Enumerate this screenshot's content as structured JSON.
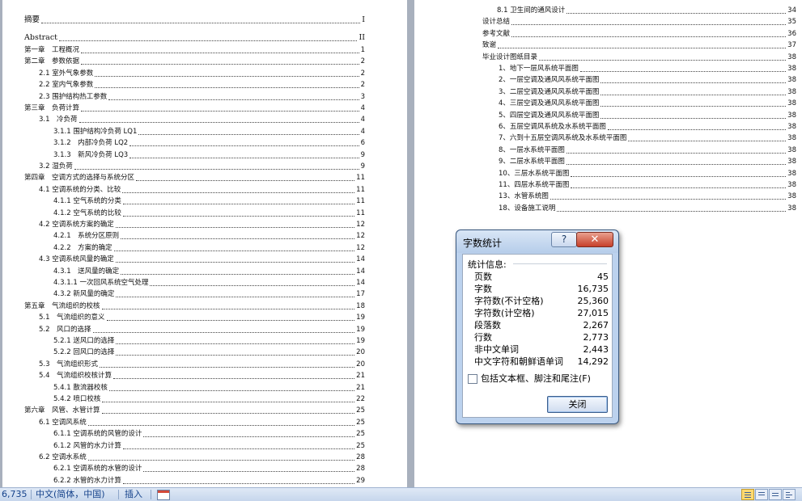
{
  "toc_left": [
    {
      "text": "摘要",
      "page": "I",
      "big": true
    },
    {
      "text": "Abstract",
      "page": "II",
      "big": true
    },
    {
      "text": "第一章　工程概况",
      "page": "1"
    },
    {
      "text": "第二章　参数依据",
      "page": "2"
    },
    {
      "text": "2.1 室外气象参数",
      "page": "2"
    },
    {
      "text": "2.2 室内气象参数",
      "page": "2"
    },
    {
      "text": "2.3 围护结构热工参数",
      "page": "3"
    },
    {
      "text": "第三章　负荷计算",
      "page": "4"
    },
    {
      "text": "3.1　冷负荷",
      "page": "4"
    },
    {
      "text": "3.1.1 围护结构冷负荷 LQ1",
      "page": "4"
    },
    {
      "text": "3.1.2　内部冷负荷 LQ2",
      "page": "6"
    },
    {
      "text": "3.1.3　新风冷负荷 LQ3",
      "page": "9"
    },
    {
      "text": "3.2 湿负荷",
      "page": "9"
    },
    {
      "text": "第四章　空调方式的选择与系统分区",
      "page": "11"
    },
    {
      "text": "4.1 空调系统的分类、比较",
      "page": "11"
    },
    {
      "text": "4.1.1 空气系统的分类",
      "page": "11"
    },
    {
      "text": "4.1.2 空气系统的比较",
      "page": "11"
    },
    {
      "text": "4.2 空调系统方案的确定",
      "page": "12"
    },
    {
      "text": "4.2.1　系统分区原则",
      "page": "12"
    },
    {
      "text": "4.2.2　方案的确定",
      "page": "12"
    },
    {
      "text": "4.3 空调系统风量的确定",
      "page": "14"
    },
    {
      "text": "4.3.1　送风量的确定",
      "page": "14"
    },
    {
      "text": "4.3.1.1 一次回风系统空气处理",
      "page": "14"
    },
    {
      "text": "4.3.2 新风量的确定",
      "page": "17"
    },
    {
      "text": "第五章　气流组织的校核",
      "page": "18"
    },
    {
      "text": "5.1　气流组织的意义",
      "page": "19"
    },
    {
      "text": "5.2　风口的选择",
      "page": "19"
    },
    {
      "text": "5.2.1 送风口的选择",
      "page": "19"
    },
    {
      "text": "5.2.2 回风口的选择",
      "page": "20"
    },
    {
      "text": "5.3　气流组织形式",
      "page": "20"
    },
    {
      "text": "5.4　气流组织校核计算",
      "page": "21"
    },
    {
      "text": "5.4.1 散流器校核",
      "page": "21"
    },
    {
      "text": "5.4.2 喷口校核",
      "page": "22"
    },
    {
      "text": "第六章　风管、水管计算",
      "page": "25"
    },
    {
      "text": "6.1 空调风系统",
      "page": "25"
    },
    {
      "text": "6.1.1 空调系统的风管的设计",
      "page": "25"
    },
    {
      "text": "6.1.2 风管的水力计算",
      "page": "25"
    },
    {
      "text": "6.2 空调水系统",
      "page": "28"
    },
    {
      "text": "6.2.1 空调系统的水管的设计",
      "page": "28"
    },
    {
      "text": "6.2.2 水管的水力计算",
      "page": "29"
    }
  ],
  "toc_right": [
    {
      "text": "8.1 卫生间的通风设计",
      "page": "34"
    },
    {
      "text": "设计总结",
      "page": "35"
    },
    {
      "text": "参考文献",
      "page": "36"
    },
    {
      "text": "致谢",
      "page": "37"
    },
    {
      "text": "毕业设计图纸目录",
      "page": "38"
    },
    {
      "text": "1、地下一层风系统平面图",
      "page": "38"
    },
    {
      "text": "2、一层空调及通风风系统平面图",
      "page": "38"
    },
    {
      "text": "3、二层空调及通风风系统平面图",
      "page": "38"
    },
    {
      "text": "4、三层空调及通风风系统平面图",
      "page": "38"
    },
    {
      "text": "5、四层空调及通风风系统平面图",
      "page": "38"
    },
    {
      "text": "6、五层空调风系统及水系统平面图",
      "page": "38"
    },
    {
      "text": "7、六到十五层空调风系统及水系统平面图",
      "page": "38"
    },
    {
      "text": "8、一层水系统平面图",
      "page": "38"
    },
    {
      "text": "9、二层水系统平面图",
      "page": "38"
    },
    {
      "text": "10、三层水系统平面图",
      "page": "38"
    },
    {
      "text": "11、四层水系统平面图",
      "page": "38"
    },
    {
      "text": "13、水管系统图",
      "page": "38"
    },
    {
      "text": "18、设备施工说明",
      "page": "38"
    }
  ],
  "status_bar": {
    "word_count": "6,735",
    "language": "中文(简体，中国)",
    "mode": "插入"
  },
  "dialog": {
    "title": "字数统计",
    "help_label": "?",
    "close_x_label": "✕",
    "section_label": "统计信息:",
    "stats": [
      {
        "label": "页数",
        "value": "45"
      },
      {
        "label": "字数",
        "value": "16,735"
      },
      {
        "label": "字符数(不计空格)",
        "value": "25,360"
      },
      {
        "label": "字符数(计空格)",
        "value": "27,015"
      },
      {
        "label": "段落数",
        "value": "2,267"
      },
      {
        "label": "行数",
        "value": "2,773"
      },
      {
        "label": "非中文单词",
        "value": "2,443"
      },
      {
        "label": "中文字符和朝鲜语单词",
        "value": "14,292"
      }
    ],
    "checkbox_label": "包括文本框、脚注和尾注(F)",
    "checkbox_checked": false,
    "close_button": "关闭"
  },
  "colors": {
    "workspace": "#a8b0bd",
    "dialog_frame": "#bcd2ee",
    "status_text": "#15428b"
  }
}
